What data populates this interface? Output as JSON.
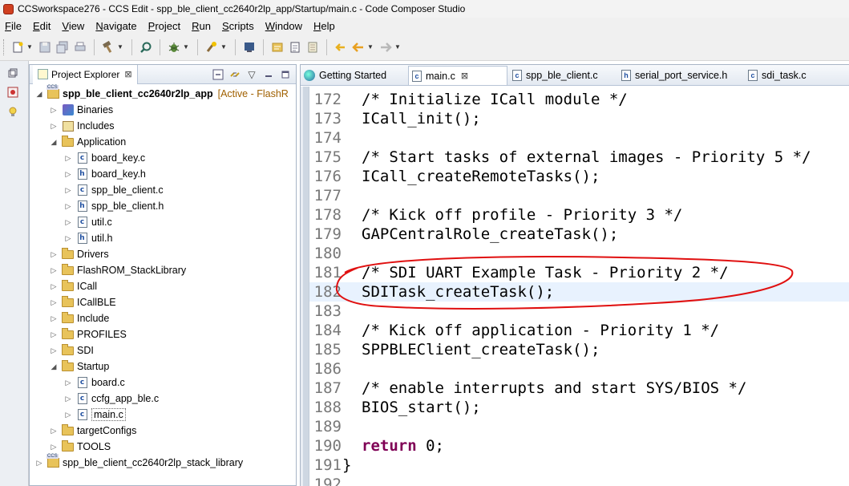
{
  "window": {
    "title": "CCSworkspace276 - CCS Edit - spp_ble_client_cc2640r2lp_app/Startup/main.c - Code Composer Studio"
  },
  "menu": [
    "File",
    "Edit",
    "View",
    "Navigate",
    "Project",
    "Run",
    "Scripts",
    "Window",
    "Help"
  ],
  "explorer": {
    "tab_label": "Project Explorer",
    "close_glyph": "⊠",
    "tree": [
      {
        "label": "spp_ble_client_cc2640r2lp_app",
        "suffix": "[Active - FlashR",
        "depth": 0,
        "icon": "project",
        "expanded": true,
        "bold": true
      },
      {
        "label": "Binaries",
        "depth": 1,
        "icon": "binaries",
        "expanded": false
      },
      {
        "label": "Includes",
        "depth": 1,
        "icon": "includes",
        "expanded": false
      },
      {
        "label": "Application",
        "depth": 1,
        "icon": "folder",
        "expanded": true
      },
      {
        "label": "board_key.c",
        "depth": 2,
        "icon": "c-file",
        "expanded": false
      },
      {
        "label": "board_key.h",
        "depth": 2,
        "icon": "h-file",
        "expanded": false
      },
      {
        "label": "spp_ble_client.c",
        "depth": 2,
        "icon": "c-file",
        "expanded": false
      },
      {
        "label": "spp_ble_client.h",
        "depth": 2,
        "icon": "h-file",
        "expanded": false
      },
      {
        "label": "util.c",
        "depth": 2,
        "icon": "c-file",
        "expanded": false
      },
      {
        "label": "util.h",
        "depth": 2,
        "icon": "h-file",
        "expanded": false
      },
      {
        "label": "Drivers",
        "depth": 1,
        "icon": "folder",
        "expanded": false
      },
      {
        "label": "FlashROM_StackLibrary",
        "depth": 1,
        "icon": "folder",
        "expanded": false
      },
      {
        "label": "ICall",
        "depth": 1,
        "icon": "folder",
        "expanded": false
      },
      {
        "label": "ICallBLE",
        "depth": 1,
        "icon": "folder",
        "expanded": false
      },
      {
        "label": "Include",
        "depth": 1,
        "icon": "folder",
        "expanded": false
      },
      {
        "label": "PROFILES",
        "depth": 1,
        "icon": "folder",
        "expanded": false
      },
      {
        "label": "SDI",
        "depth": 1,
        "icon": "folder",
        "expanded": false
      },
      {
        "label": "Startup",
        "depth": 1,
        "icon": "folder",
        "expanded": true
      },
      {
        "label": "board.c",
        "depth": 2,
        "icon": "c-file",
        "expanded": false
      },
      {
        "label": "ccfg_app_ble.c",
        "depth": 2,
        "icon": "c-file",
        "expanded": false
      },
      {
        "label": "main.c",
        "depth": 2,
        "icon": "c-file",
        "expanded": false,
        "selected": true
      },
      {
        "label": "targetConfigs",
        "depth": 1,
        "icon": "folder",
        "expanded": false
      },
      {
        "label": "TOOLS",
        "depth": 1,
        "icon": "folder",
        "expanded": false
      },
      {
        "label": "spp_ble_client_cc2640r2lp_stack_library",
        "depth": 0,
        "icon": "project",
        "expanded": false
      }
    ]
  },
  "editor": {
    "tabs": [
      {
        "label": "Getting Started",
        "icon": "globe-icon",
        "active": false
      },
      {
        "label": "main.c",
        "icon": "c-file-icon",
        "active": true,
        "close": "⊠"
      },
      {
        "label": "spp_ble_client.c",
        "icon": "c-file-icon",
        "active": false
      },
      {
        "label": "serial_port_service.h",
        "icon": "h-file-icon",
        "active": false
      },
      {
        "label": "sdi_task.c",
        "icon": "c-file-icon",
        "active": false
      }
    ],
    "lines": [
      {
        "num": "172",
        "text": "/* Initialize ICall module */",
        "kind": "comment"
      },
      {
        "num": "173",
        "text": "ICall_init();",
        "kind": "code"
      },
      {
        "num": "174",
        "text": "",
        "kind": "code"
      },
      {
        "num": "175",
        "text": "/* Start tasks of external images - Priority 5 */",
        "kind": "comment"
      },
      {
        "num": "176",
        "text": "ICall_createRemoteTasks();",
        "kind": "code"
      },
      {
        "num": "177",
        "text": "",
        "kind": "code"
      },
      {
        "num": "178",
        "text": "/* Kick off profile - Priority 3 */",
        "kind": "comment"
      },
      {
        "num": "179",
        "text": "GAPCentralRole_createTask();",
        "kind": "code"
      },
      {
        "num": "180",
        "text": "",
        "kind": "code"
      },
      {
        "num": "181",
        "text": "/* SDI UART Example Task - Priority 2 */",
        "kind": "comment"
      },
      {
        "num": "182",
        "text": "SDITask_createTask();",
        "kind": "code",
        "current": true
      },
      {
        "num": "183",
        "text": "",
        "kind": "code"
      },
      {
        "num": "184",
        "text": "/* Kick off application - Priority 1 */",
        "kind": "comment"
      },
      {
        "num": "185",
        "text": "SPPBLEClient_createTask();",
        "kind": "code"
      },
      {
        "num": "186",
        "text": "",
        "kind": "code"
      },
      {
        "num": "187",
        "text": "/* enable interrupts and start SYS/BIOS */",
        "kind": "comment"
      },
      {
        "num": "188",
        "text": "BIOS_start();",
        "kind": "code"
      },
      {
        "num": "189",
        "text": "",
        "kind": "code"
      },
      {
        "num": "190",
        "text": "return 0;",
        "kind": "return"
      },
      {
        "num": "191",
        "text": "}",
        "kind": "brace"
      },
      {
        "num": "192",
        "text": "",
        "kind": "code"
      }
    ]
  },
  "colors": {
    "comment": "#3f7f5f",
    "keyword": "#7f0055",
    "current_line": "#e8f2fe",
    "annotation": "#e01010"
  }
}
